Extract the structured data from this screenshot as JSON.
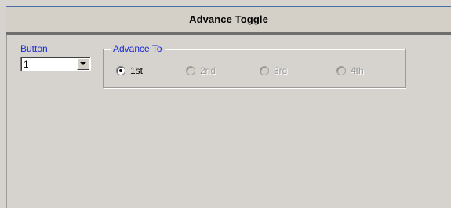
{
  "window": {
    "title": "Advance Toggle"
  },
  "button_field": {
    "label": "Button",
    "value": "1"
  },
  "advance_to": {
    "legend": "Advance To",
    "options": [
      {
        "label": "1st",
        "selected": true,
        "enabled": true
      },
      {
        "label": "2nd",
        "selected": false,
        "enabled": false
      },
      {
        "label": "3rd",
        "selected": false,
        "enabled": false
      },
      {
        "label": "4th",
        "selected": false,
        "enabled": false
      }
    ]
  },
  "colors": {
    "label_blue": "#1a2ad6",
    "panel_gray": "#d4d0c8",
    "disabled_text": "#9a9a9a"
  }
}
